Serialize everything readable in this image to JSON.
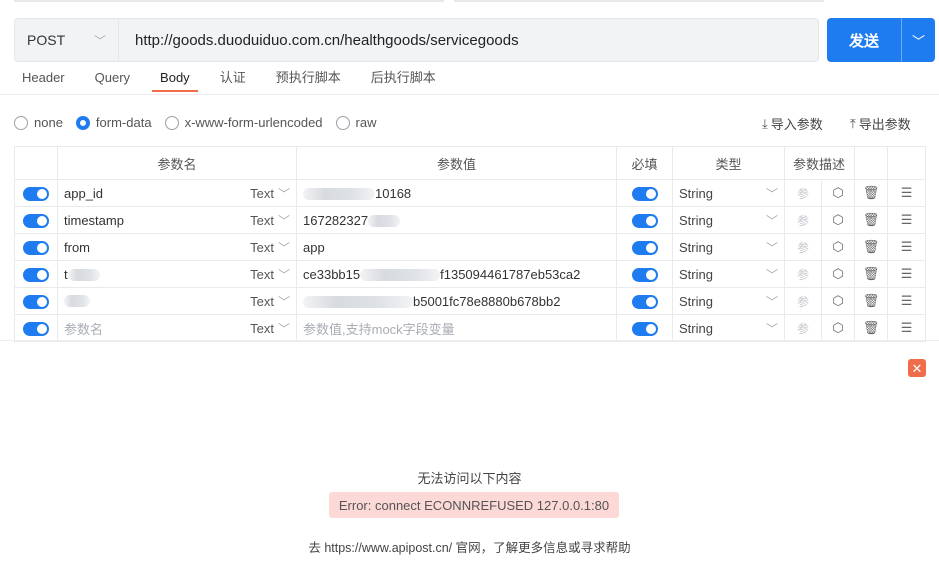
{
  "request": {
    "method": "POST",
    "url": "http://goods.duoduiduo.com.cn/healthgoods/servicegoods",
    "send_label": "发送",
    "accent_color": "#1f7cf0"
  },
  "tabs": [
    "Header",
    "Query",
    "Body",
    "认证",
    "预执行脚本",
    "后执行脚本"
  ],
  "active_tab": "Body",
  "body_types": [
    "none",
    "form-data",
    "x-www-form-urlencoded",
    "raw"
  ],
  "selected_body_type": "form-data",
  "bulk_actions": {
    "import": "导入参数",
    "export": "导出参数"
  },
  "table": {
    "headers": {
      "name": "参数名",
      "value": "参数值",
      "required": "必填",
      "type": "类型",
      "desc": "参数描述"
    },
    "rows": [
      {
        "name": "app_id",
        "field_type": "Text",
        "value": "10168",
        "type": "String",
        "desc_placeholder": "参"
      },
      {
        "name": "timestamp",
        "field_type": "Text",
        "value": "167282327",
        "type": "String",
        "desc_placeholder": "参"
      },
      {
        "name": "from",
        "field_type": "Text",
        "value": "app",
        "type": "String",
        "desc_placeholder": "参"
      },
      {
        "name": "t",
        "field_type": "Text",
        "value_prefix": "ce33bb15",
        "value": "f135094461787eb53ca2",
        "type": "String",
        "desc_placeholder": "参"
      },
      {
        "name": "",
        "field_type": "Text",
        "value": "b5001fc78e8880b678bb2",
        "type": "String",
        "desc_placeholder": "参"
      },
      {
        "name_placeholder": "参数名",
        "field_type": "Text",
        "value_placeholder": "参数值,支持mock字段变量",
        "type": "String",
        "desc_placeholder": "参"
      }
    ]
  },
  "error": {
    "title": "无法访问以下内容",
    "message": "Error: connect ECONNREFUSED 127.0.0.1:80",
    "help": "去 https://www.apipost.cn/ 官网，了解更多信息或寻求帮助",
    "close_color": "#ef6d4a"
  }
}
